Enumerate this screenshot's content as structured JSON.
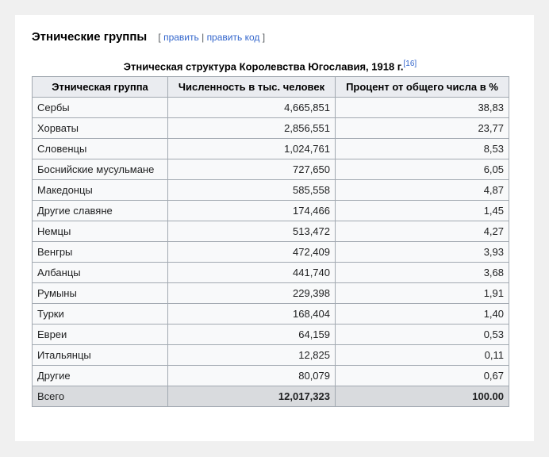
{
  "section": {
    "title": "Этнические группы",
    "edit_open": "[",
    "edit_label": "править",
    "edit_sep": "|",
    "edit_code_label": "править код",
    "edit_close": "]"
  },
  "table": {
    "caption": "Этническая структура Королевства Югославия, 1918 г.",
    "footnote": "[16]",
    "headers": [
      "Этническая группа",
      "Численность в тыс. человек",
      "Процент от общего числа в %"
    ],
    "rows": [
      {
        "group": "Сербы",
        "count": "4,665,851",
        "percent": "38,83"
      },
      {
        "group": "Хорваты",
        "count": "2,856,551",
        "percent": "23,77"
      },
      {
        "group": "Словенцы",
        "count": "1,024,761",
        "percent": "8,53"
      },
      {
        "group": "Боснийские мусульмане",
        "count": "727,650",
        "percent": "6,05"
      },
      {
        "group": "Македонцы",
        "count": "585,558",
        "percent": "4,87"
      },
      {
        "group": "Другие славяне",
        "count": "174,466",
        "percent": "1,45"
      },
      {
        "group": "Немцы",
        "count": "513,472",
        "percent": "4,27"
      },
      {
        "group": "Венгры",
        "count": "472,409",
        "percent": "3,93"
      },
      {
        "group": "Албанцы",
        "count": "441,740",
        "percent": "3,68"
      },
      {
        "group": "Румыны",
        "count": "229,398",
        "percent": "1,91"
      },
      {
        "group": "Турки",
        "count": "168,404",
        "percent": "1,40"
      },
      {
        "group": "Евреи",
        "count": "64,159",
        "percent": "0,53"
      },
      {
        "group": "Итальянцы",
        "count": "12,825",
        "percent": "0,11"
      },
      {
        "group": "Другие",
        "count": "80,079",
        "percent": "0,67"
      }
    ],
    "total": {
      "group": "Всего",
      "count": "12,017,323",
      "percent": "100.00"
    }
  }
}
